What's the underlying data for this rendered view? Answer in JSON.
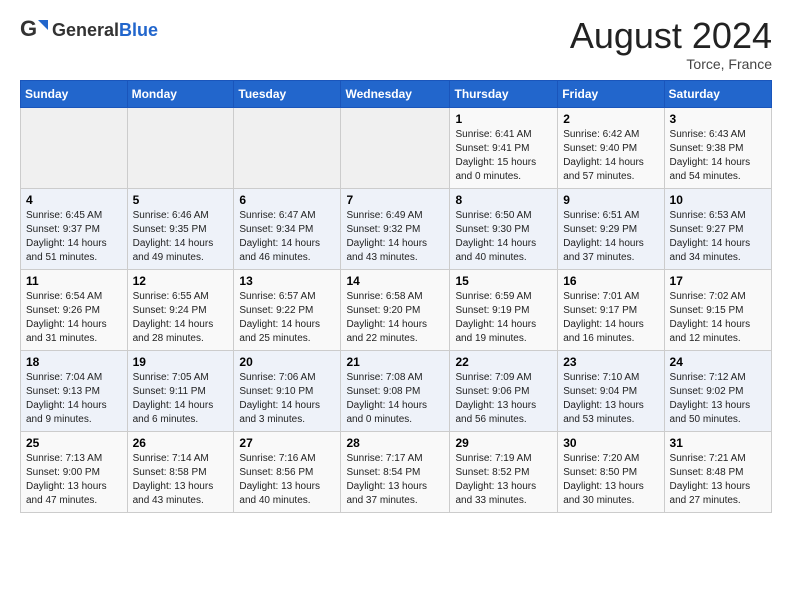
{
  "header": {
    "logo_general": "General",
    "logo_blue": "Blue",
    "title": "August 2024",
    "location": "Torce, France"
  },
  "days_of_week": [
    "Sunday",
    "Monday",
    "Tuesday",
    "Wednesday",
    "Thursday",
    "Friday",
    "Saturday"
  ],
  "weeks": [
    [
      {
        "day": "",
        "info": ""
      },
      {
        "day": "",
        "info": ""
      },
      {
        "day": "",
        "info": ""
      },
      {
        "day": "",
        "info": ""
      },
      {
        "day": "1",
        "info": "Sunrise: 6:41 AM\nSunset: 9:41 PM\nDaylight: 15 hours\nand 0 minutes."
      },
      {
        "day": "2",
        "info": "Sunrise: 6:42 AM\nSunset: 9:40 PM\nDaylight: 14 hours\nand 57 minutes."
      },
      {
        "day": "3",
        "info": "Sunrise: 6:43 AM\nSunset: 9:38 PM\nDaylight: 14 hours\nand 54 minutes."
      }
    ],
    [
      {
        "day": "4",
        "info": "Sunrise: 6:45 AM\nSunset: 9:37 PM\nDaylight: 14 hours\nand 51 minutes."
      },
      {
        "day": "5",
        "info": "Sunrise: 6:46 AM\nSunset: 9:35 PM\nDaylight: 14 hours\nand 49 minutes."
      },
      {
        "day": "6",
        "info": "Sunrise: 6:47 AM\nSunset: 9:34 PM\nDaylight: 14 hours\nand 46 minutes."
      },
      {
        "day": "7",
        "info": "Sunrise: 6:49 AM\nSunset: 9:32 PM\nDaylight: 14 hours\nand 43 minutes."
      },
      {
        "day": "8",
        "info": "Sunrise: 6:50 AM\nSunset: 9:30 PM\nDaylight: 14 hours\nand 40 minutes."
      },
      {
        "day": "9",
        "info": "Sunrise: 6:51 AM\nSunset: 9:29 PM\nDaylight: 14 hours\nand 37 minutes."
      },
      {
        "day": "10",
        "info": "Sunrise: 6:53 AM\nSunset: 9:27 PM\nDaylight: 14 hours\nand 34 minutes."
      }
    ],
    [
      {
        "day": "11",
        "info": "Sunrise: 6:54 AM\nSunset: 9:26 PM\nDaylight: 14 hours\nand 31 minutes."
      },
      {
        "day": "12",
        "info": "Sunrise: 6:55 AM\nSunset: 9:24 PM\nDaylight: 14 hours\nand 28 minutes."
      },
      {
        "day": "13",
        "info": "Sunrise: 6:57 AM\nSunset: 9:22 PM\nDaylight: 14 hours\nand 25 minutes."
      },
      {
        "day": "14",
        "info": "Sunrise: 6:58 AM\nSunset: 9:20 PM\nDaylight: 14 hours\nand 22 minutes."
      },
      {
        "day": "15",
        "info": "Sunrise: 6:59 AM\nSunset: 9:19 PM\nDaylight: 14 hours\nand 19 minutes."
      },
      {
        "day": "16",
        "info": "Sunrise: 7:01 AM\nSunset: 9:17 PM\nDaylight: 14 hours\nand 16 minutes."
      },
      {
        "day": "17",
        "info": "Sunrise: 7:02 AM\nSunset: 9:15 PM\nDaylight: 14 hours\nand 12 minutes."
      }
    ],
    [
      {
        "day": "18",
        "info": "Sunrise: 7:04 AM\nSunset: 9:13 PM\nDaylight: 14 hours\nand 9 minutes."
      },
      {
        "day": "19",
        "info": "Sunrise: 7:05 AM\nSunset: 9:11 PM\nDaylight: 14 hours\nand 6 minutes."
      },
      {
        "day": "20",
        "info": "Sunrise: 7:06 AM\nSunset: 9:10 PM\nDaylight: 14 hours\nand 3 minutes."
      },
      {
        "day": "21",
        "info": "Sunrise: 7:08 AM\nSunset: 9:08 PM\nDaylight: 14 hours\nand 0 minutes."
      },
      {
        "day": "22",
        "info": "Sunrise: 7:09 AM\nSunset: 9:06 PM\nDaylight: 13 hours\nand 56 minutes."
      },
      {
        "day": "23",
        "info": "Sunrise: 7:10 AM\nSunset: 9:04 PM\nDaylight: 13 hours\nand 53 minutes."
      },
      {
        "day": "24",
        "info": "Sunrise: 7:12 AM\nSunset: 9:02 PM\nDaylight: 13 hours\nand 50 minutes."
      }
    ],
    [
      {
        "day": "25",
        "info": "Sunrise: 7:13 AM\nSunset: 9:00 PM\nDaylight: 13 hours\nand 47 minutes."
      },
      {
        "day": "26",
        "info": "Sunrise: 7:14 AM\nSunset: 8:58 PM\nDaylight: 13 hours\nand 43 minutes."
      },
      {
        "day": "27",
        "info": "Sunrise: 7:16 AM\nSunset: 8:56 PM\nDaylight: 13 hours\nand 40 minutes."
      },
      {
        "day": "28",
        "info": "Sunrise: 7:17 AM\nSunset: 8:54 PM\nDaylight: 13 hours\nand 37 minutes."
      },
      {
        "day": "29",
        "info": "Sunrise: 7:19 AM\nSunset: 8:52 PM\nDaylight: 13 hours\nand 33 minutes."
      },
      {
        "day": "30",
        "info": "Sunrise: 7:20 AM\nSunset: 8:50 PM\nDaylight: 13 hours\nand 30 minutes."
      },
      {
        "day": "31",
        "info": "Sunrise: 7:21 AM\nSunset: 8:48 PM\nDaylight: 13 hours\nand 27 minutes."
      }
    ]
  ]
}
